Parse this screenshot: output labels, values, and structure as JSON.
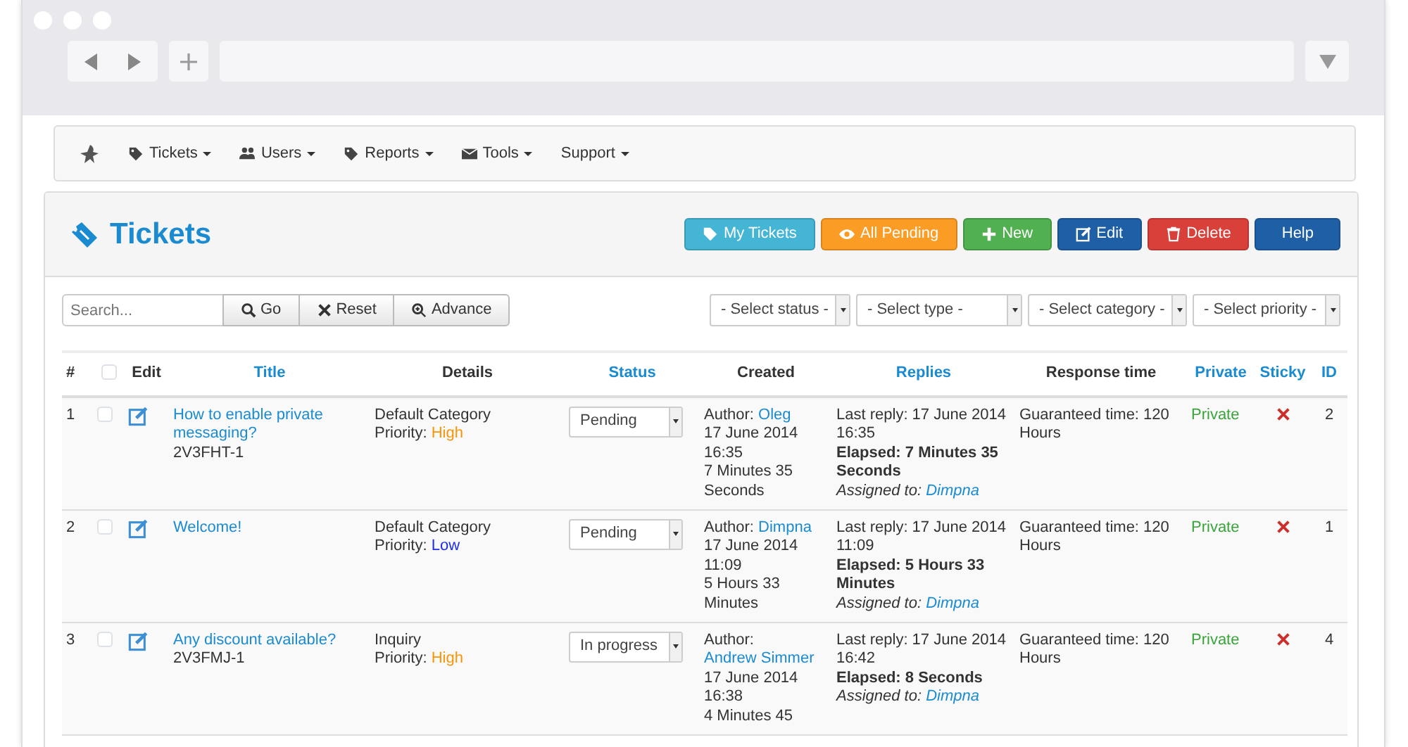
{
  "nav": {
    "items": [
      {
        "kind": "tag",
        "label": "Tickets"
      },
      {
        "kind": "users",
        "label": "Users"
      },
      {
        "kind": "tag",
        "label": "Reports"
      },
      {
        "kind": "envelope",
        "label": "Tools"
      },
      {
        "kind": "none",
        "label": "Support"
      }
    ]
  },
  "header": {
    "title": "Tickets",
    "buttons": [
      {
        "kind": "tag",
        "label": "My Tickets",
        "color": "#45b5d6"
      },
      {
        "kind": "eye",
        "label": "All Pending",
        "color": "#fb9c25"
      },
      {
        "kind": "plus",
        "label": "New",
        "color": "#51b04f"
      },
      {
        "kind": "edit",
        "label": "Edit",
        "color": "#1f5fa5"
      },
      {
        "kind": "trash",
        "label": "Delete",
        "color": "#d9403a"
      },
      {
        "kind": "none",
        "label": "Help",
        "color": "#1f5fa5"
      }
    ]
  },
  "search": {
    "placeholder": "Search...",
    "buttons": [
      {
        "kind": "search",
        "label": "Go"
      },
      {
        "kind": "cross",
        "label": "Reset"
      },
      {
        "kind": "zoom",
        "label": "Advance"
      }
    ]
  },
  "filters": [
    "- Select status -",
    "- Select type -",
    "- Select category -",
    "- Select priority -"
  ],
  "table": {
    "columns": [
      {
        "label": "#",
        "sortable": false
      },
      {
        "kind": "checkbox",
        "checked": false
      },
      {
        "label": "Edit",
        "sortable": false
      },
      {
        "label": "Title",
        "sortable": true
      },
      {
        "label": "Details",
        "sortable": false
      },
      {
        "label": "Status",
        "sortable": true
      },
      {
        "label": "Created",
        "sortable": false
      },
      {
        "label": "Replies",
        "sortable": true
      },
      {
        "label": "Response time",
        "sortable": false
      },
      {
        "label": "Private",
        "sortable": true
      },
      {
        "label": "Sticky",
        "sortable": true
      },
      {
        "label": "ID",
        "sortable": true
      }
    ],
    "rows": [
      {
        "number": "1",
        "checked": false,
        "title": "How to enable private messaging?",
        "code": "2V3FHT-1",
        "category": "Default Category",
        "priority_label": "Priority:",
        "priority": {
          "label": "High",
          "color": "#f89406"
        },
        "status": "Pending",
        "author_label": "Author:",
        "author": "Oleg",
        "created": "17 June 2014 16:35",
        "age": "7 Minutes 35 Seconds",
        "last_reply": "Last reply: 17 June 2014 16:35",
        "elapsed": "Elapsed: 7 Minutes 35 Seconds",
        "assigned_label": "Assigned to:",
        "assigned": "Dimpna",
        "response": "Guaranteed time: 120 Hours",
        "private": "Private",
        "sticky": false,
        "id": "2"
      },
      {
        "number": "2",
        "checked": false,
        "title": "Welcome!",
        "category": "Default Category",
        "priority_label": "Priority:",
        "priority": {
          "label": "Low",
          "color": "#1b2ee6"
        },
        "status": "Pending",
        "author_label": "Author:",
        "author": "Dimpna",
        "created": "17 June 2014 11:09",
        "age": "5 Hours 33 Minutes",
        "last_reply": "Last reply: 17 June 2014 11:09",
        "elapsed": "Elapsed: 5 Hours 33 Minutes",
        "assigned_label": "Assigned to:",
        "assigned": "Dimpna",
        "response": "Guaranteed time: 120 Hours",
        "private": "Private",
        "sticky": false,
        "id": "1"
      },
      {
        "number": "3",
        "checked": false,
        "title": "Any discount available?",
        "code": "2V3FMJ-1",
        "category": "Inquiry",
        "priority_label": "Priority:",
        "priority": {
          "label": "High",
          "color": "#f89406"
        },
        "status": "In progress",
        "author_label": "Author:",
        "author": "Andrew Simmer",
        "created": "17 June 2014 16:38",
        "age": "4 Minutes 45",
        "last_reply": "Last reply: 17 June 2014 16:42",
        "elapsed": "Elapsed: 8 Seconds",
        "assigned_label": "Assigned to:",
        "assigned": "Dimpna",
        "response": "Guaranteed time: 120 Hours",
        "private": "Private",
        "sticky": false,
        "id": "4"
      }
    ]
  }
}
